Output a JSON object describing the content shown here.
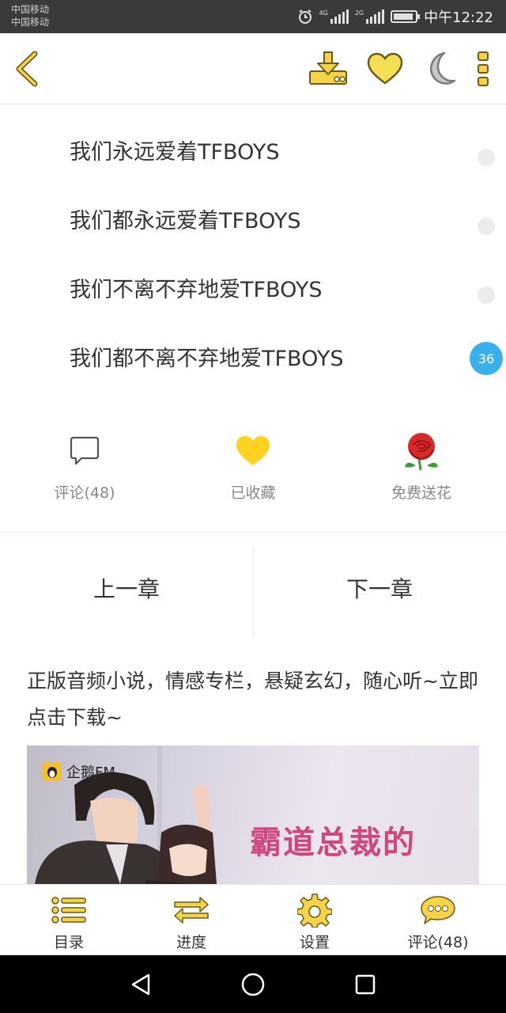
{
  "status_bar": {
    "carrier_1": "中国移动",
    "carrier_2": "中国移动",
    "net_1": "4G",
    "net_2": "2G",
    "time": "中午12:22"
  },
  "top_bar": {
    "icons": [
      "back-chevron-icon",
      "download-icon",
      "heart-icon",
      "moon-icon",
      "more-vertical-icon"
    ],
    "accent_color": "#f5d44a"
  },
  "content": {
    "paragraphs": [
      "我们永远爱着TFBOYS",
      "我们都永远爱着TFBOYS",
      "我们不离不弃地爱TFBOYS",
      "我们都不离不弃地爱TFBOYS"
    ],
    "comment_badge": "36"
  },
  "actions": {
    "comment_label": "评论(48)",
    "favorite_label": "已收藏",
    "flower_label": "免费送花"
  },
  "chapter_nav": {
    "prev": "上一章",
    "next": "下一章"
  },
  "promo": {
    "text": "正版音频小说，情感专栏，悬疑玄幻，随心听~立即点击下载~",
    "banner_brand": "企鹅FM",
    "banner_title": "霸道总裁的"
  },
  "bottom_tabs": {
    "catalog": "目录",
    "progress": "进度",
    "settings": "设置",
    "comments": "评论(48)"
  }
}
